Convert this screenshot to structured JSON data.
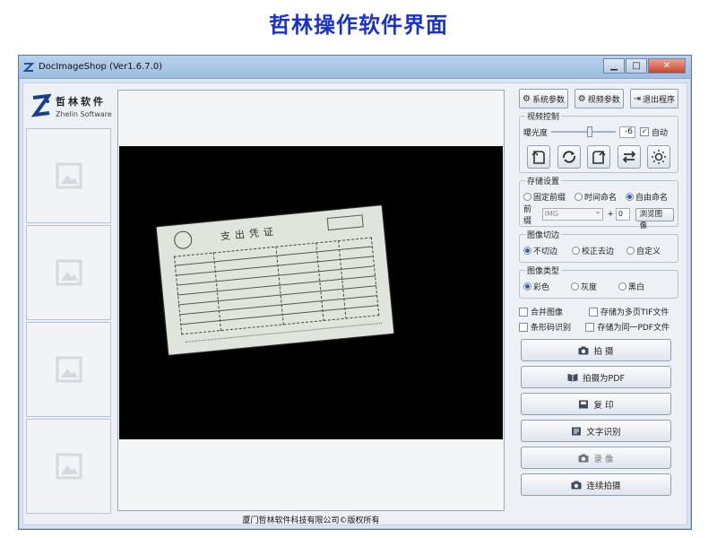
{
  "page_heading": "哲林操作软件界面",
  "window": {
    "title": "DocImageShop (Ver1.6.7.0)",
    "min_glyph": "▁",
    "max_glyph": "□",
    "close_glyph": "✕"
  },
  "logo": {
    "name": "哲林软件",
    "sub": "Zhelin Software"
  },
  "top_buttons": {
    "system_params": "系统参数",
    "video_params": "视频参数",
    "exit": "退出程序"
  },
  "video_control": {
    "legend": "视频控制",
    "exposure_label": "曝光度",
    "exposure_value": "-6",
    "exposure_fraction": 0.6,
    "auto_label": "自动",
    "auto_checked": true,
    "icons": [
      "rotate-left-icon",
      "refresh-icon",
      "rotate-right-icon",
      "swap-icon",
      "brightness-icon"
    ]
  },
  "storage": {
    "legend": "存储设置",
    "options": [
      "固定前缀",
      "时间命名",
      "自由命名"
    ],
    "selected": 2,
    "prefix_label": "前缀",
    "prefix_value": "IMG",
    "plus": "+",
    "counter_value": "0",
    "browse_label": "浏览图像"
  },
  "crop": {
    "legend": "图像切边",
    "options": [
      "不切边",
      "校正去边",
      "自定义"
    ],
    "selected": 0
  },
  "image_type": {
    "legend": "图像类型",
    "options": [
      "彩色",
      "灰度",
      "黑白"
    ],
    "selected": 0
  },
  "checkboxes": {
    "merge": "合并图像",
    "save_tif": "存储为多页TIF文件",
    "barcode": "条形码识别",
    "save_pdf": "存储为同一PDF文件"
  },
  "actions": {
    "capture": "拍    摄",
    "capture_pdf": "拍摄为PDF",
    "copy": "复    印",
    "ocr": "文字识别",
    "record": "录    像",
    "continuous": "连续拍摄"
  },
  "document": {
    "title": "支出凭证"
  },
  "copyright": "厦门哲林软件科技有限公司©版权所有"
}
